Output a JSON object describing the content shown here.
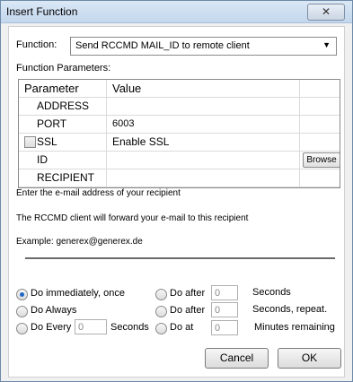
{
  "window": {
    "title": "Insert Function",
    "close_glyph": "✕"
  },
  "function": {
    "label": "Function:",
    "selected": "Send RCCMD MAIL_ID to remote client",
    "arrow": "▼"
  },
  "params": {
    "label": "Function Parameters:",
    "headers": [
      "Parameter",
      "Value"
    ],
    "rows": [
      {
        "name": "ADDRESS",
        "value": ""
      },
      {
        "name": "PORT",
        "value": "6003"
      },
      {
        "name": "SSL",
        "value": "Enable SSL",
        "checked": false
      },
      {
        "name": "ID",
        "value": "",
        "button": "Browse"
      },
      {
        "name": "RECIPIENT",
        "value": ""
      }
    ]
  },
  "description": {
    "line1": "Enter the e-mail address of your recipient",
    "line2": "The RCCMD client will forward your e-mail to this recipient",
    "line3": "Example: generex@generex.de"
  },
  "schedule": {
    "do_immediately": "Do immediately, once",
    "do_always": "Do Always",
    "do_every": "Do Every",
    "do_every_value": "0",
    "do_every_unit": "Seconds",
    "do_after_1": "Do after",
    "do_after_1_value": "0",
    "do_after_1_unit": "Seconds",
    "do_after_2": "Do after",
    "do_after_2_value": "0",
    "do_after_2_unit": "Seconds, repeat.",
    "do_at": "Do at",
    "do_at_value": "0",
    "do_at_unit": "Minutes remaining",
    "selected": "do_immediately"
  },
  "buttons": {
    "cancel": "Cancel",
    "ok": "OK"
  }
}
